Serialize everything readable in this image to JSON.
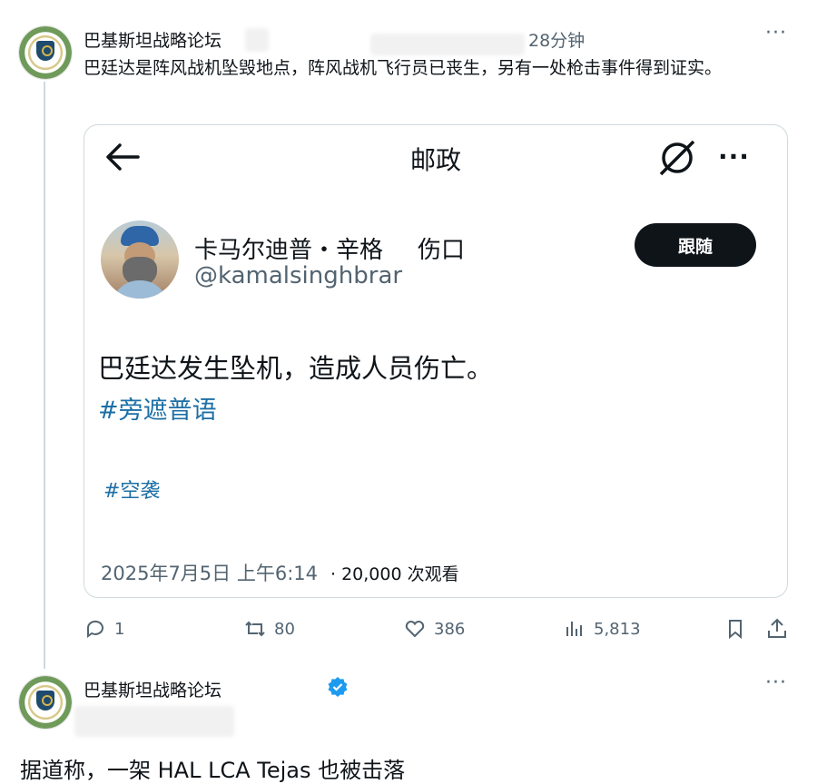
{
  "post1": {
    "author": "巴基斯坦战略论坛",
    "time": "28分钟",
    "more": "···",
    "text": "巴廷达是阵风战机坠毁地点，阵风战机飞行员已丧生，另有一处枪击事件得到证实。",
    "quote": {
      "header_title": "邮政",
      "header_more": "···",
      "author_name": "卡马尔迪普・辛格",
      "author_extra": "伤口",
      "handle": "@kamalsinghbrar",
      "follow_label": "跟随",
      "text": "巴廷达发生坠机，造成人员伤亡。",
      "hashtag1": "#旁遮普语",
      "hashtag2": "#空袭",
      "date": "2025年7月5日 上午6:14",
      "views": "· 20,000 次观看"
    },
    "actions": {
      "replies": "1",
      "retweets": "80",
      "likes": "386",
      "views": "5,813"
    }
  },
  "post2": {
    "author": "巴基斯坦战略论坛",
    "more": "···",
    "verified_color": "#1d9bf0",
    "text": "据道称，一架 HAL LCA Tejas 也被击落"
  },
  "colors": {
    "text": "#0f1419",
    "muted": "#536471",
    "link": "#1d6fa5",
    "border": "#cfd9de"
  }
}
